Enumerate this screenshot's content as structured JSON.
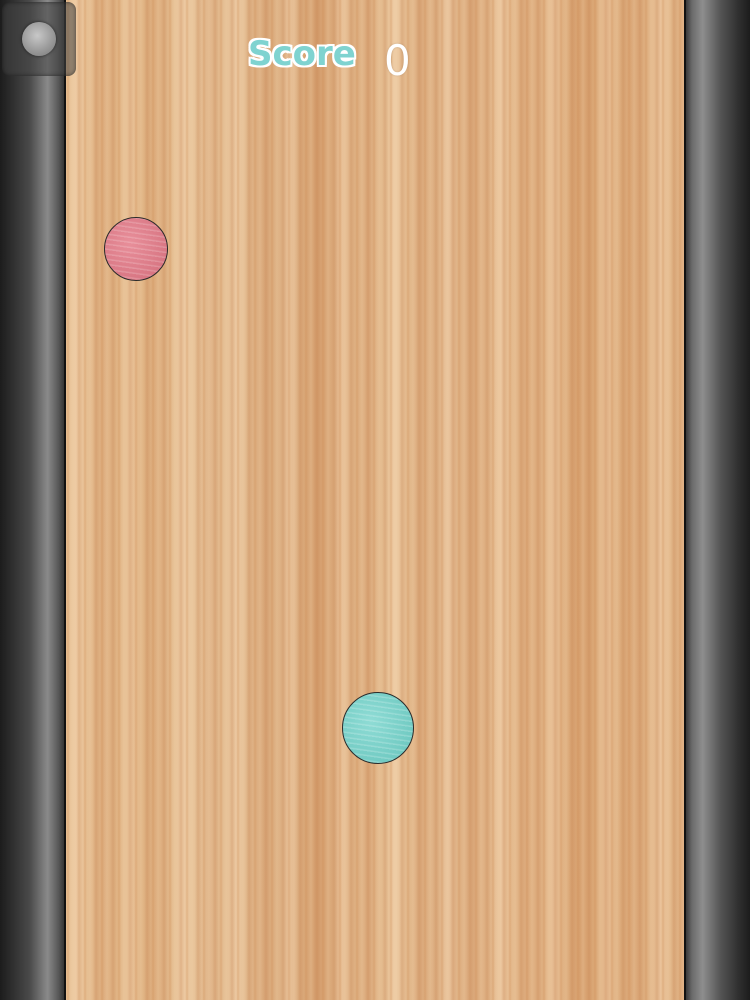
{
  "hud": {
    "score_label": "Score",
    "score_value": "0"
  },
  "controls": {
    "pause_icon": "pause-circle-icon"
  },
  "colors": {
    "board": "#e2b789",
    "rail": "#3a3a3a",
    "pink_ball": "#e0808c",
    "teal_ball": "#7fd3cc",
    "score_label": "#7fd3d0"
  }
}
